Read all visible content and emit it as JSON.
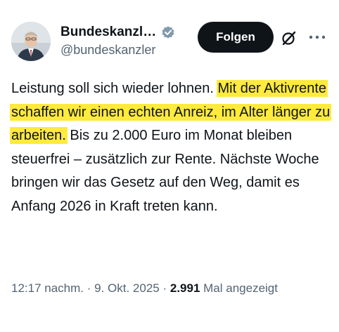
{
  "author": {
    "display_name": "Bundeskanzl…",
    "handle": "@bundeskanzler",
    "verified_color": "#829aab"
  },
  "actions": {
    "follow_label": "Folgen",
    "grok_icon": "grok-icon",
    "more_icon": "more-icon"
  },
  "tweet": {
    "text_before": "Leistung soll sich wieder lohnen. ",
    "text_highlight": "Mit der Aktivrente schaffen wir einen echten Anreiz, im Alter länger zu arbeiten.",
    "text_after": " Bis zu 2.000 Euro im Monat bleiben steuerfrei – zusätzlich zur Rente. Nächste Woche bringen wir das Gesetz auf den Weg, damit es Anfang 2026 in Kraft treten kann.",
    "highlight_color": "#ffea3d"
  },
  "meta": {
    "time": "12:17 nachm.",
    "separator": " · ",
    "date": "9. Okt. 2025",
    "views_count": "2.991",
    "views_label": "Mal angezeigt"
  }
}
